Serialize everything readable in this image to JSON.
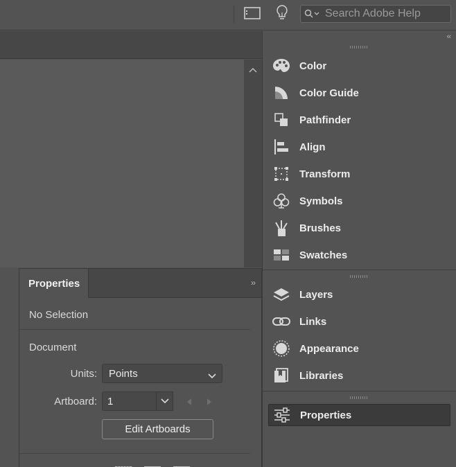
{
  "topbar": {
    "search_placeholder": "Search Adobe Help"
  },
  "dock": {
    "collapse_glyph": "‹‹",
    "groups": [
      {
        "items": [
          {
            "label": "Color",
            "icon": "palette-icon"
          },
          {
            "label": "Color Guide",
            "icon": "color-guide-icon"
          },
          {
            "label": "Pathfinder",
            "icon": "pathfinder-icon"
          },
          {
            "label": "Align",
            "icon": "align-icon"
          },
          {
            "label": "Transform",
            "icon": "transform-icon"
          },
          {
            "label": "Symbols",
            "icon": "club-icon"
          },
          {
            "label": "Brushes",
            "icon": "brushes-icon"
          },
          {
            "label": "Swatches",
            "icon": "swatches-icon"
          }
        ]
      },
      {
        "items": [
          {
            "label": "Layers",
            "icon": "layers-icon"
          },
          {
            "label": "Links",
            "icon": "links-icon"
          },
          {
            "label": "Appearance",
            "icon": "appearance-icon"
          },
          {
            "label": "Libraries",
            "icon": "libraries-icon"
          }
        ]
      },
      {
        "items": [
          {
            "label": "Properties",
            "icon": "sliders-icon",
            "active": true
          }
        ]
      }
    ]
  },
  "properties_panel": {
    "tab_label": "Properties",
    "expand_glyph": "››",
    "selection_status": "No Selection",
    "section_title": "Document",
    "units_label": "Units:",
    "units_value": "Points",
    "artboard_label": "Artboard:",
    "artboard_value": "1",
    "edit_artboards_label": "Edit Artboards"
  },
  "colors": {
    "panel_bg": "#535353",
    "dark_bg": "#474747",
    "active_item_bg": "#3b3b3b",
    "text": "#ececec"
  }
}
